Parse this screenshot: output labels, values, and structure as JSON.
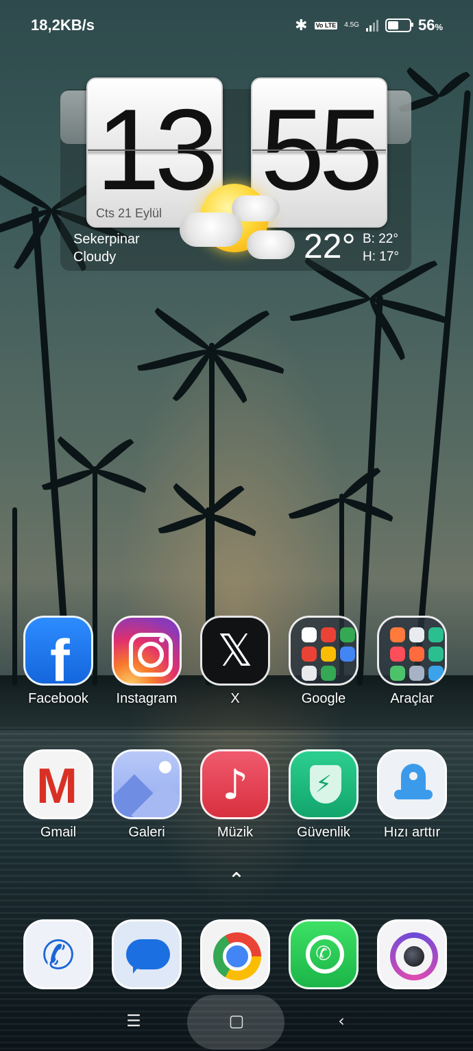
{
  "status_bar": {
    "net_speed": "18,2KB/s",
    "bluetooth_icon": "bluetooth-icon",
    "volte": "Vo LTE",
    "network": "4.5G",
    "battery_pct": "56",
    "battery_unit": "%",
    "battery_level": 0.56
  },
  "clock_widget": {
    "hour": "13",
    "minute": "55",
    "date": "Cts 21 Eylül",
    "location": "Sekerpinar",
    "condition": "Cloudy",
    "temperature": "22°",
    "high": "B: 22°",
    "low": "H: 17°",
    "weather_icon": "partly-cloudy-icon"
  },
  "apps_row1": [
    {
      "label": "Facebook",
      "icon": "facebook-icon"
    },
    {
      "label": "Instagram",
      "icon": "instagram-icon"
    },
    {
      "label": "X",
      "icon": "x-icon"
    },
    {
      "label": "Google",
      "icon": "folder-icon"
    },
    {
      "label": "Araçlar",
      "icon": "folder-icon"
    }
  ],
  "apps_row2": [
    {
      "label": "Gmail",
      "icon": "gmail-icon"
    },
    {
      "label": "Galeri",
      "icon": "gallery-icon"
    },
    {
      "label": "Müzik",
      "icon": "music-icon"
    },
    {
      "label": "Güvenlik",
      "icon": "security-shield-icon"
    },
    {
      "label": "Hızı arttır",
      "icon": "rocket-icon"
    }
  ],
  "dock": [
    {
      "icon": "phone-icon"
    },
    {
      "icon": "messages-icon"
    },
    {
      "icon": "chrome-icon"
    },
    {
      "icon": "whatsapp-icon"
    },
    {
      "icon": "camera-icon"
    }
  ],
  "glyphs": {
    "fb": "f",
    "x": "𝕏",
    "gmail": "M",
    "note": "♪",
    "bolt": "⚡",
    "phone": "✆",
    "wa_phone": "✆",
    "chevron": "⌃",
    "recents": "☰",
    "home": "▢",
    "back": "‹"
  },
  "colors": {
    "facebook": "#1877f2",
    "gmail_red": "#d93025",
    "whatsapp": "#25d366"
  }
}
